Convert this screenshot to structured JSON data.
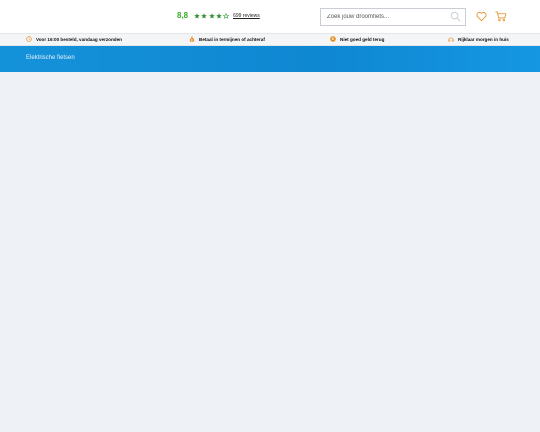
{
  "header": {
    "rating": {
      "score": "8,8",
      "stars_full": 4,
      "stars_total": 5,
      "reviews_label": "699 reviews"
    },
    "search": {
      "placeholder": "Zoek jouw droomfiets..."
    }
  },
  "usp_bar": [
    {
      "icon": "clock-icon",
      "label": "Voor 16:00 besteld, vandaag verzonden"
    },
    {
      "icon": "money-bag-icon",
      "label": "Betaal in termijnen of achteraf"
    },
    {
      "icon": "money-back-icon",
      "label": "Niet goed geld terug"
    },
    {
      "icon": "delivery-icon",
      "label": "Rijklaar morgen in huis"
    }
  ],
  "hero": {
    "breadcrumb": "Elektrische fietsen"
  },
  "colors": {
    "rating_green": "#3aa82a",
    "star_green": "#2f8f2f",
    "accent_orange": "#e58a1f",
    "hero_blue": "#1190d8",
    "page_background": "#eef2f6"
  }
}
